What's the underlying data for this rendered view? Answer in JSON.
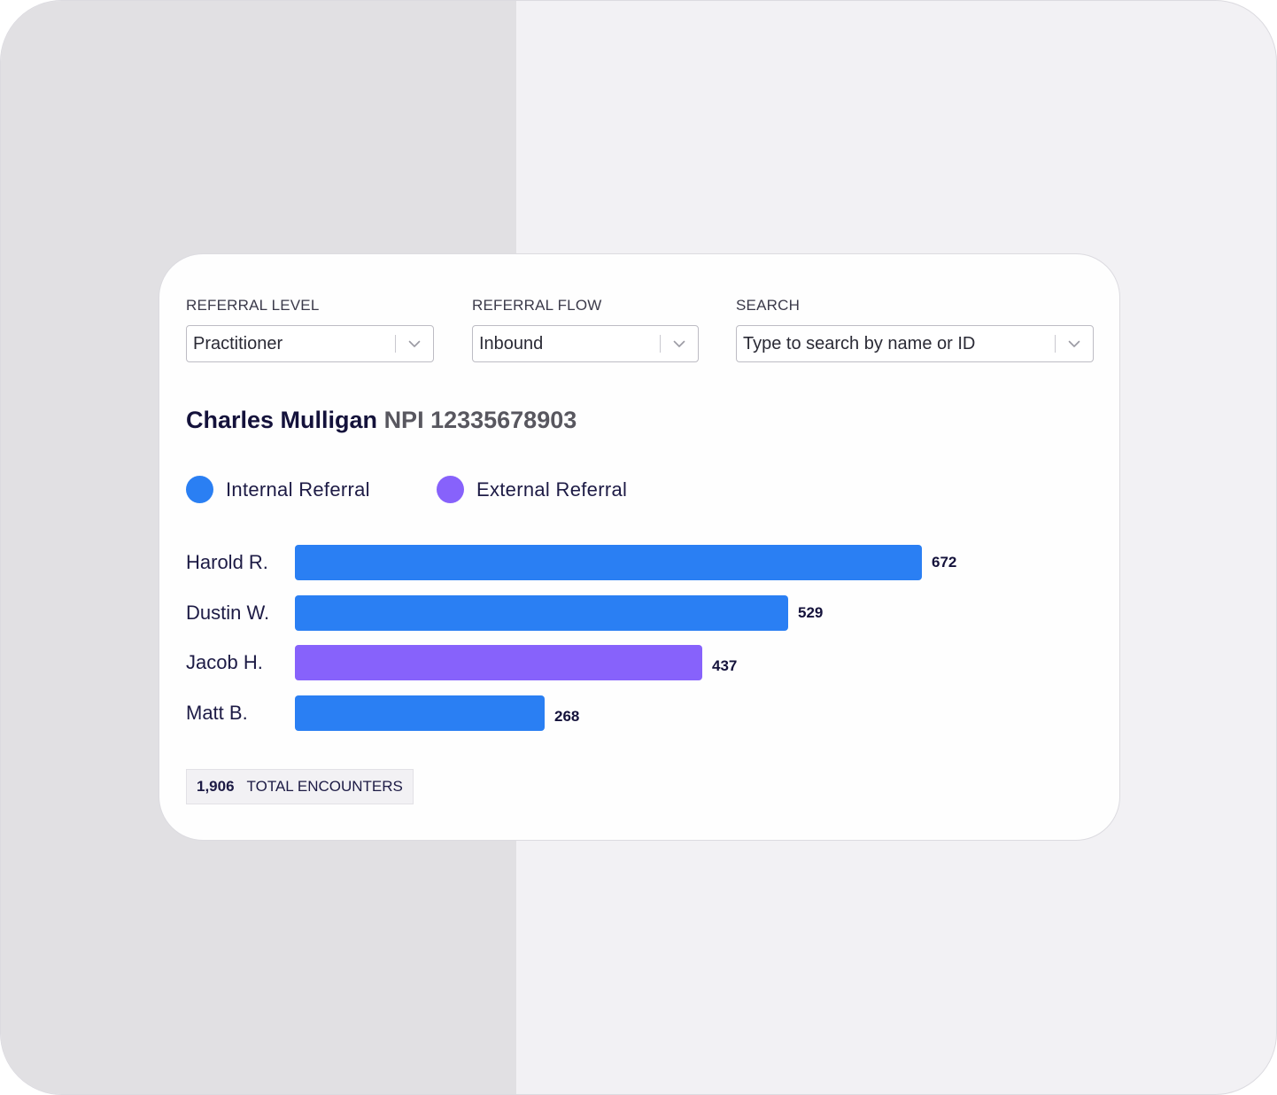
{
  "filters": {
    "referral_level": {
      "label": "REFERRAL LEVEL",
      "value": "Practitioner"
    },
    "referral_flow": {
      "label": "REFERRAL FLOW",
      "value": "Inbound"
    },
    "search": {
      "label": "SEARCH",
      "placeholder": "Type to search by name or ID"
    }
  },
  "provider": {
    "name": "Charles Mulligan",
    "npi": "NPI 12335678903"
  },
  "legend": {
    "internal": {
      "label": "Internal Referral",
      "color": "#2a7ff3"
    },
    "external": {
      "label": "External Referral",
      "color": "#8762fb"
    }
  },
  "chart_data": {
    "type": "bar",
    "orientation": "horizontal",
    "categories": [
      "Harold R.",
      "Dustin W.",
      "Jacob H.",
      "Matt B."
    ],
    "values": [
      672,
      529,
      437,
      268
    ],
    "series_type": [
      "Internal Referral",
      "Internal Referral",
      "External Referral",
      "Internal Referral"
    ]
  },
  "totals": {
    "count": "1,906",
    "label": "TOTAL ENCOUNTERS"
  },
  "icons": {
    "dropdown": "chevron-down-icon"
  }
}
